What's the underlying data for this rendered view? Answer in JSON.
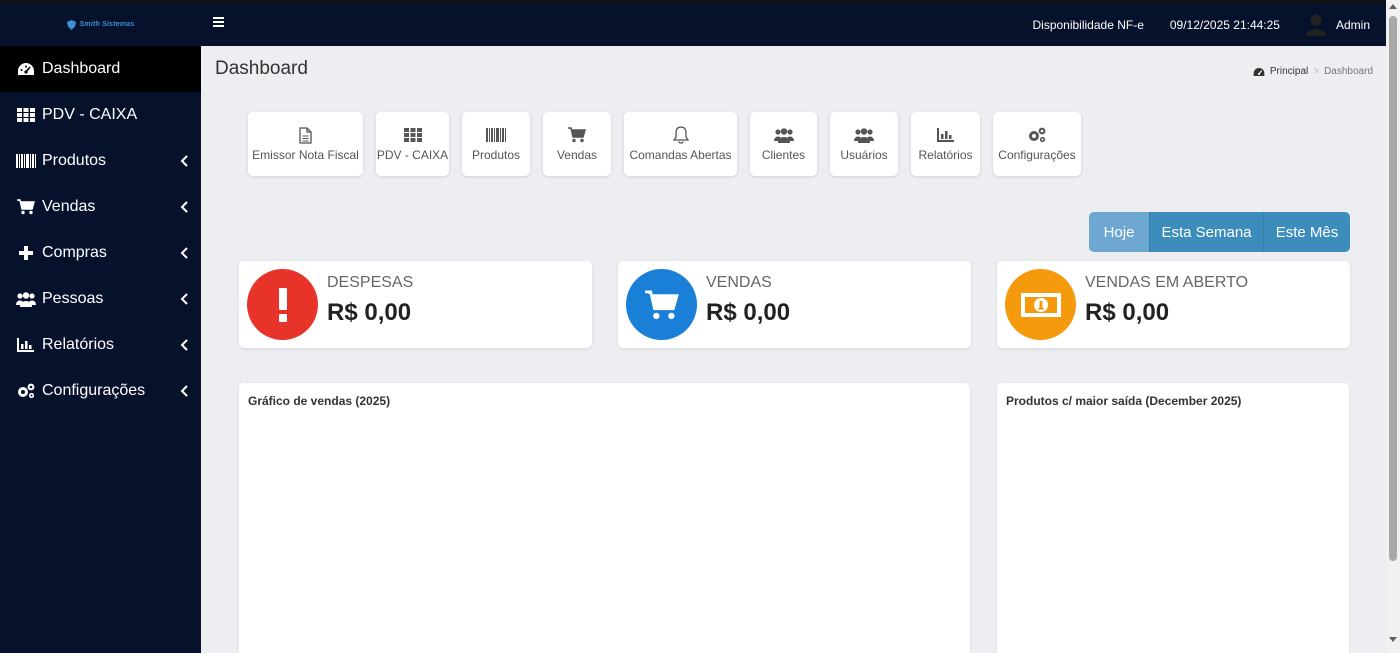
{
  "app": {
    "logo_text": "Smith Sistemas",
    "nfe_status": "Disponibilidade NF-e",
    "datetime": "09/12/2025 21:44:25",
    "user": "Admin"
  },
  "sidebar": {
    "items": [
      {
        "label": "Dashboard",
        "icon": "dashboard-icon"
      },
      {
        "label": "PDV - CAIXA",
        "icon": "grid-icon"
      },
      {
        "label": "Produtos",
        "icon": "barcode-icon"
      },
      {
        "label": "Vendas",
        "icon": "cart-icon"
      },
      {
        "label": "Compras",
        "icon": "plus-icon"
      },
      {
        "label": "Pessoas",
        "icon": "users-icon"
      },
      {
        "label": "Relatórios",
        "icon": "bar-chart-icon"
      },
      {
        "label": "Configurações",
        "icon": "cogs-icon"
      }
    ]
  },
  "page": {
    "title": "Dashboard",
    "breadcrumb_home": "Principal",
    "breadcrumb_current": "Dashboard"
  },
  "shortcuts": [
    {
      "label": "Emissor Nota Fiscal",
      "icon": "file-icon"
    },
    {
      "label": "PDV - CAIXA",
      "icon": "grid-icon"
    },
    {
      "label": "Produtos",
      "icon": "barcode-icon"
    },
    {
      "label": "Vendas",
      "icon": "cart-icon"
    },
    {
      "label": "Comandas Abertas",
      "icon": "bell-icon"
    },
    {
      "label": "Clientes",
      "icon": "users-icon"
    },
    {
      "label": "Usuários",
      "icon": "users-icon"
    },
    {
      "label": "Relatórios",
      "icon": "bar-chart-icon"
    },
    {
      "label": "Configurações",
      "icon": "cogs-icon"
    }
  ],
  "period_filter": {
    "hoje": "Hoje",
    "semana": "Esta Semana",
    "mes": "Este Mês",
    "selected": "Hoje"
  },
  "stats": [
    {
      "label": "DESPESAS",
      "value": "R$ 0,00",
      "icon": "exclamation-icon",
      "color": "#e8332a"
    },
    {
      "label": "VENDAS",
      "value": "R$ 0,00",
      "icon": "cart-icon",
      "color": "#1a7fd6"
    },
    {
      "label": "VENDAS EM ABERTO",
      "value": "R$ 0,00",
      "icon": "money-icon",
      "color": "#f59a0c"
    }
  ],
  "panels": {
    "sales_chart_title": "Gráfico de vendas (2025)",
    "top_products_title": "Produtos c/ maior saída (December 2025)"
  },
  "colors": {
    "sidebar_bg": "#06112b",
    "accent": "#3c8dbc"
  }
}
